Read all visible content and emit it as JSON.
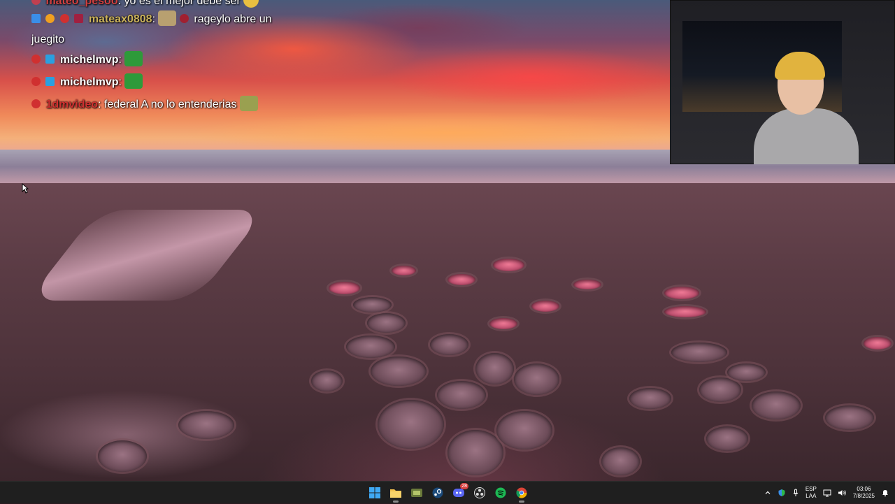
{
  "chat": {
    "messages": [
      {
        "user": "mateo_pesoo",
        "user_color": "#d04040",
        "text": "yo es el mejor debe ser"
      },
      {
        "user": "mateax0808",
        "user_color": "#c9b15a",
        "text": "rageylo abre un"
      },
      {
        "continuation": "juegito"
      },
      {
        "user": "michelmvp",
        "user_color": "#ffffff",
        "text": ""
      },
      {
        "user": "michelmvp",
        "user_color": "#ffffff",
        "text": ""
      },
      {
        "user": "1dmvideo",
        "user_color": "#d03030",
        "text": "federal A no lo entenderias"
      }
    ]
  },
  "taskbar": {
    "apps": [
      {
        "name": "Start",
        "icon": "windows-logo-icon"
      },
      {
        "name": "File Explorer",
        "icon": "folder-icon"
      },
      {
        "name": "Xbox",
        "icon": "xbox-icon"
      },
      {
        "name": "Steam",
        "icon": "steam-icon"
      },
      {
        "name": "Discord",
        "icon": "discord-icon",
        "badge": "28"
      },
      {
        "name": "OBS",
        "icon": "obs-icon"
      },
      {
        "name": "Spotify",
        "icon": "spotify-icon"
      },
      {
        "name": "Chrome",
        "icon": "chrome-icon"
      }
    ],
    "tray": {
      "lang_top": "ESP",
      "lang_bottom": "LAA",
      "time": "03:06",
      "date": "7/8/2025"
    }
  },
  "colors": {
    "taskbar_bg": "#1f1f1f",
    "discord": "#5865f2",
    "spotify": "#1db954"
  }
}
